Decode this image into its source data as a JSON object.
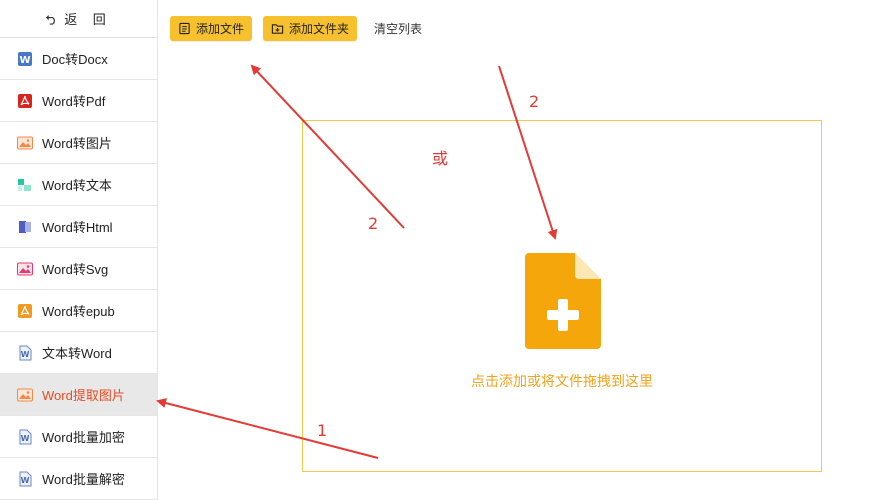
{
  "sidebar": {
    "back_label": "返 回",
    "items": [
      {
        "label": "Doc转Docx",
        "icon": "word-doc-icon"
      },
      {
        "label": "Word转Pdf",
        "icon": "pdf-icon"
      },
      {
        "label": "Word转图片",
        "icon": "image-icon"
      },
      {
        "label": "Word转文本",
        "icon": "text-icon"
      },
      {
        "label": "Word转Html",
        "icon": "html-icon"
      },
      {
        "label": "Word转Svg",
        "icon": "svg-image-icon"
      },
      {
        "label": "Word转epub",
        "icon": "epub-icon"
      },
      {
        "label": "文本转Word",
        "icon": "word-file-icon"
      },
      {
        "label": "Word提取图片",
        "icon": "image-icon",
        "active": true
      },
      {
        "label": "Word批量加密",
        "icon": "word-file-icon"
      },
      {
        "label": "Word批量解密",
        "icon": "word-file-icon"
      }
    ]
  },
  "toolbar": {
    "add_file_label": "添加文件",
    "add_folder_label": "添加文件夹",
    "clear_list_label": "清空列表"
  },
  "dropzone": {
    "hint": "点击添加或将文件拖拽到这里"
  },
  "annotations": {
    "or_label": "或",
    "step1": "1",
    "step2_left": "2",
    "step2_top": "2"
  },
  "colors": {
    "accent": "#f6c12c",
    "active_text": "#e94b25",
    "drop_border": "#f2c94c",
    "hint_text": "#f3a21b",
    "annotation": "#e53935"
  }
}
